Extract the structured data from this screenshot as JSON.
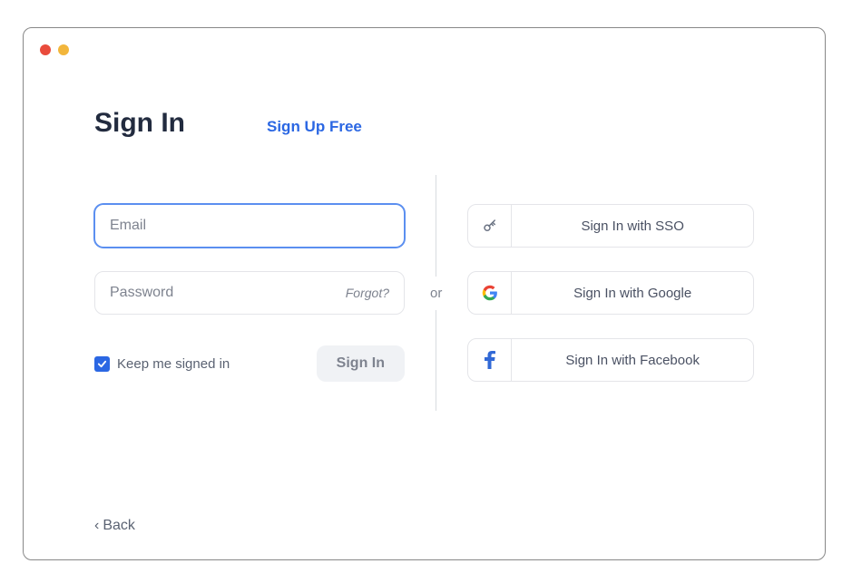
{
  "header": {
    "active_tab": "Sign In",
    "signup_link": "Sign Up Free"
  },
  "form": {
    "email_placeholder": "Email",
    "email_value": "",
    "password_placeholder": "Password",
    "password_value": "",
    "forgot_label": "Forgot?",
    "keep_signed_in_label": "Keep me signed in",
    "keep_signed_in_checked": true,
    "submit_label": "Sign In"
  },
  "divider": {
    "or_label": "or"
  },
  "oauth": {
    "sso_label": "Sign In with SSO",
    "google_label": "Sign In with Google",
    "facebook_label": "Sign In with Facebook"
  },
  "footer": {
    "back_label": "Back"
  },
  "colors": {
    "accent": "#2b67e3",
    "text_muted": "#7e838f"
  }
}
